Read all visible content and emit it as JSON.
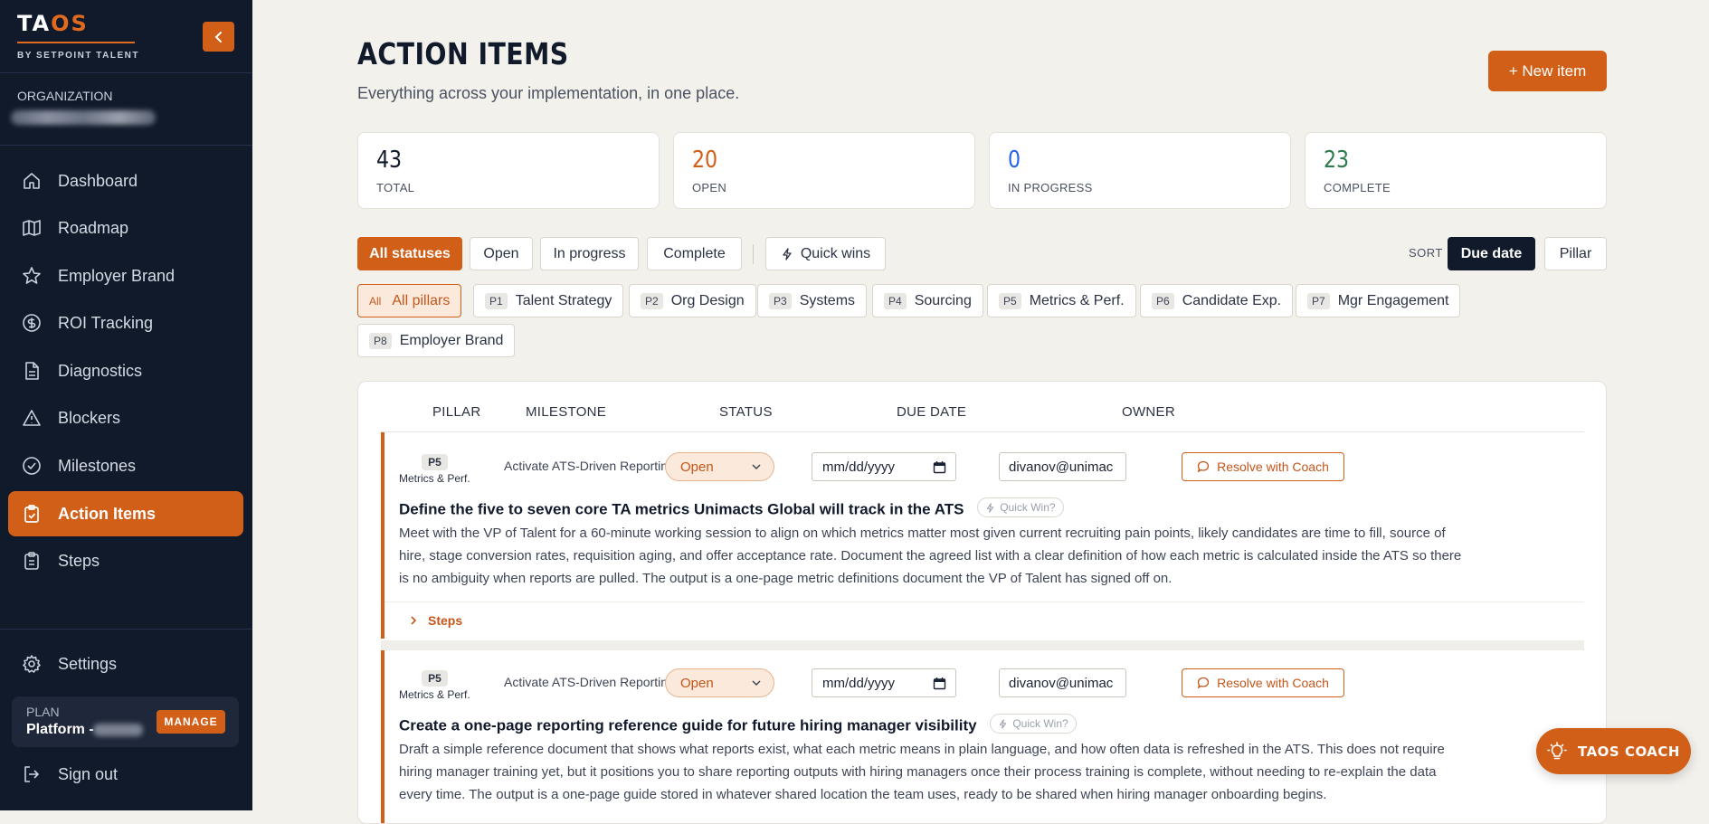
{
  "app": {
    "logo_a": "TA",
    "logo_b": "OS",
    "tagline": "BY SETPOINT TALENT"
  },
  "sidebar": {
    "org_label": "ORGANIZATION",
    "items": [
      {
        "label": "Dashboard",
        "icon": "home-icon"
      },
      {
        "label": "Roadmap",
        "icon": "map-icon"
      },
      {
        "label": "Employer Brand",
        "icon": "star-icon"
      },
      {
        "label": "ROI Tracking",
        "icon": "dollar-circle-icon"
      },
      {
        "label": "Diagnostics",
        "icon": "document-icon"
      },
      {
        "label": "Blockers",
        "icon": "warning-triangle-icon"
      },
      {
        "label": "Milestones",
        "icon": "check-circle-icon"
      },
      {
        "label": "Action Items",
        "icon": "clipboard-check-icon",
        "active": true
      },
      {
        "label": "Steps",
        "icon": "clipboard-list-icon"
      }
    ],
    "settings_label": "Settings",
    "plan_label": "PLAN",
    "plan_name": "Platform -",
    "manage_label": "MANAGE",
    "signout_label": "Sign out"
  },
  "header": {
    "title": "ACTION ITEMS",
    "subtitle": "Everything across your implementation, in one place.",
    "new_item_label": "+ New item"
  },
  "stats": [
    {
      "value": "43",
      "label": "TOTAL",
      "color": "#111a2b"
    },
    {
      "value": "20",
      "label": "OPEN",
      "color": "#d25f17"
    },
    {
      "value": "0",
      "label": "IN PROGRESS",
      "color": "#2563eb"
    },
    {
      "value": "23",
      "label": "COMPLETE",
      "color": "#2f7a4f"
    }
  ],
  "filters": {
    "status": [
      "All statuses",
      "Open",
      "In progress",
      "Complete"
    ],
    "quick_wins": "Quick wins",
    "sort_label": "SORT",
    "sort_options": [
      "Due date",
      "Pillar"
    ]
  },
  "pillars": [
    {
      "tag": "All",
      "label": "All pillars"
    },
    {
      "tag": "P1",
      "label": "Talent Strategy"
    },
    {
      "tag": "P2",
      "label": "Org Design"
    },
    {
      "tag": "P3",
      "label": "Systems"
    },
    {
      "tag": "P4",
      "label": "Sourcing"
    },
    {
      "tag": "P5",
      "label": "Metrics & Perf."
    },
    {
      "tag": "P6",
      "label": "Candidate Exp."
    },
    {
      "tag": "P7",
      "label": "Mgr Engagement"
    },
    {
      "tag": "P8",
      "label": "Employer Brand"
    }
  ],
  "table": {
    "headers": [
      "PILLAR",
      "MILESTONE",
      "STATUS",
      "DUE DATE",
      "OWNER"
    ],
    "items": [
      {
        "pillar_tag": "P5",
        "pillar_name": "Metrics & Perf.",
        "milestone": "Activate ATS-Driven Reporting",
        "status": "Open",
        "due_date": "mm/dd/yyyy",
        "owner": "divanov@unimac",
        "resolve_label": "Resolve with Coach",
        "title": "Define the five to seven core TA metrics Unimacts Global will track in the ATS",
        "quick_win": "Quick Win?",
        "desc1": "Meet with the VP of Talent for a 60-minute working session to align on which metrics matter most given current recruiting pain points, likely candidates are time to fill, source of",
        "desc2": "hire, stage conversion rates, requisition aging, and offer acceptance rate. Document the agreed list with a clear definition of how each metric is calculated inside the ATS so there",
        "desc3": "is no ambiguity when reports are pulled. The output is a one-page metric definitions document the VP of Talent has signed off on.",
        "steps_label": "Steps"
      },
      {
        "pillar_tag": "P5",
        "pillar_name": "Metrics & Perf.",
        "milestone": "Activate ATS-Driven Reporting",
        "status": "Open",
        "due_date": "mm/dd/yyyy",
        "owner": "divanov@unimac",
        "resolve_label": "Resolve with Coach",
        "title": "Create a one-page reporting reference guide for future hiring manager visibility",
        "quick_win": "Quick Win?",
        "desc1": "Draft a simple reference document that shows what reports exist, what each metric means in plain language, and how often data is refreshed in the ATS. This does not require",
        "desc2": "hiring manager training yet, but it positions you to share reporting outputs with hiring managers once their process training is complete, without needing to re-explain the data",
        "desc3": "every time. The output is a one-page guide stored in whatever shared location the team uses, ready to be shared when hiring manager onboarding begins."
      }
    ]
  },
  "coach_label": "TAOS COACH",
  "colors": {
    "sidebar_bg": "#111a2b",
    "accent": "#d25f17",
    "page_bg": "#f3f1ec"
  }
}
